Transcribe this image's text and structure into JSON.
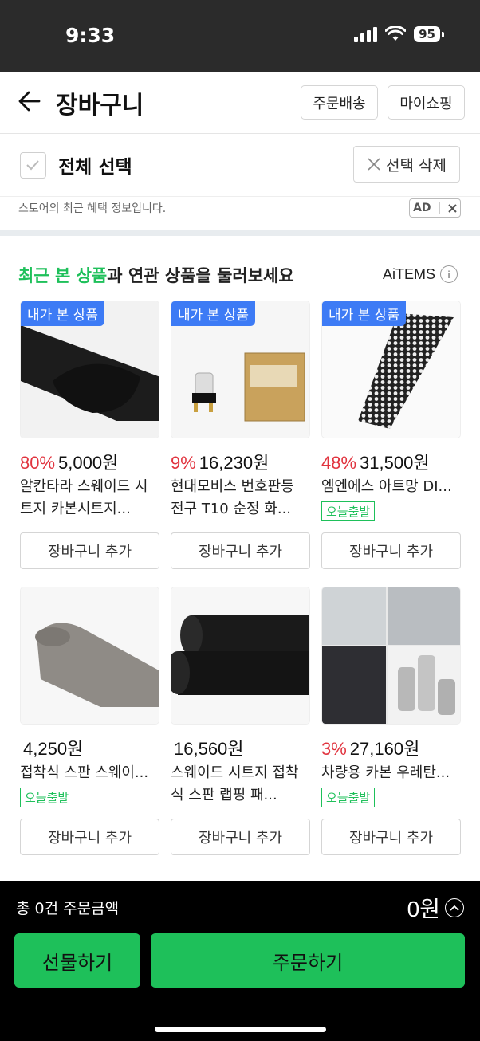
{
  "status": {
    "time": "9:33",
    "battery": "95"
  },
  "header": {
    "title": "장바구니",
    "order_delivery": "주문배송",
    "my_shopping": "마이쇼핑"
  },
  "select_bar": {
    "select_all": "전체 선택",
    "delete_selected": "선택 삭제"
  },
  "ad": {
    "text": "스토어의 최근 혜택 정보입니다.",
    "badge": "AD"
  },
  "recommend": {
    "heading_highlight": "최근 본 상품",
    "heading_rest": "과 연관 상품을 둘러보세요",
    "brand": "AiTEMS",
    "info": "i",
    "seen_badge": "내가 본 상품",
    "today_badge": "오늘출발",
    "add_to_cart": "장바구니 추가",
    "products": [
      {
        "discount": "80%",
        "price": "5,000원",
        "name": "알칸타라 스웨이드 시트지 카본시트지..."
      },
      {
        "discount": "9%",
        "price": "16,230원",
        "name": "현대모비스 번호판등 전구 T10 순정 화..."
      },
      {
        "discount": "48%",
        "price": "31,500원",
        "name": "엠엔에스 아트망 DI..."
      },
      {
        "discount": "",
        "price": "4,250원",
        "name": "접착식 스판 스웨이..."
      },
      {
        "discount": "",
        "price": "16,560원",
        "name": "스웨이드 시트지 접착식 스판 랩핑 패..."
      },
      {
        "discount": "3%",
        "price": "27,160원",
        "name": "차량용 카본 우레탄..."
      }
    ]
  },
  "footer": {
    "total_label": "총 0건 주문금액",
    "total_amount": "0원",
    "gift": "선물하기",
    "order": "주문하기"
  },
  "colors": {
    "accent": "#1ec05a",
    "discount": "#e1343f",
    "badge_blue": "#3d7bf5"
  }
}
